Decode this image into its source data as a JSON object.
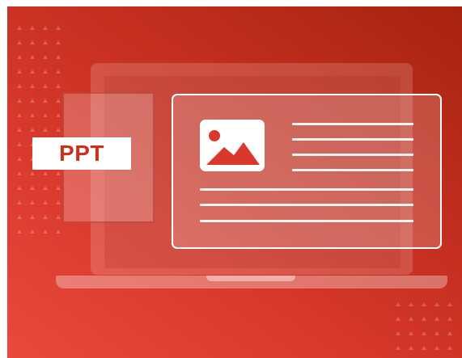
{
  "slide_label": {
    "text": "PPT"
  },
  "colors": {
    "background_start": "#e8493c",
    "background_end": "#a8230f",
    "label_text": "#c8321f",
    "outline": "#ffffff"
  },
  "icons": {
    "image": "image-icon",
    "laptop": "laptop-icon"
  }
}
